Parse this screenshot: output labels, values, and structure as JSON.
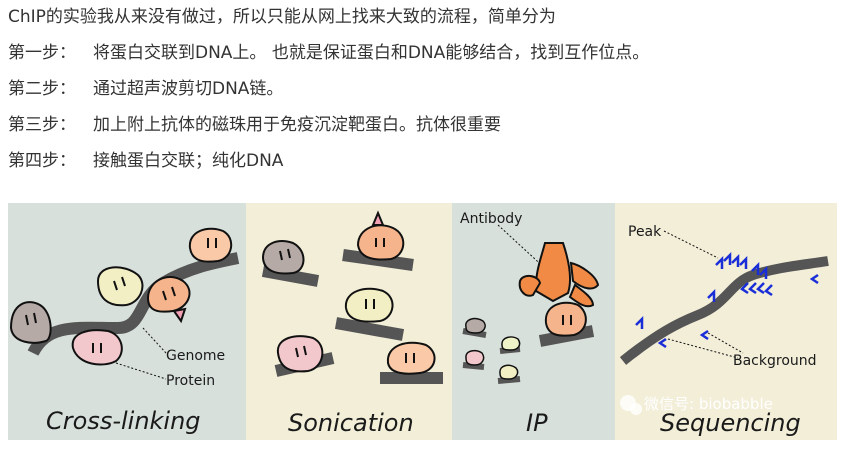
{
  "intro": "ChIP的实验我从来没有做过，所以只能从网上找来大致的流程，简单分为",
  "steps": [
    {
      "label": "第一步：",
      "text": "将蛋白交联到DNA上。 也就是保证蛋白和DNA能够结合，找到互作位点。"
    },
    {
      "label": "第二步：",
      "text": "通过超声波剪切DNA链。"
    },
    {
      "label": "第三步：",
      "text": "加上附上抗体的磁珠用于免疫沉淀靶蛋白。抗体很重要"
    },
    {
      "label": "第四步：",
      "text": "接触蛋白交联；纯化DNA"
    }
  ],
  "figure": {
    "panels": [
      {
        "title": "Cross-linking",
        "color": "#d8e0db"
      },
      {
        "title": "Sonication",
        "color": "#f2eed8"
      },
      {
        "title": "IP",
        "color": "#d8e0db"
      },
      {
        "title": "Sequencing",
        "color": "#f2eed8"
      }
    ],
    "labels": {
      "genome": "Genome",
      "protein": "Protein",
      "antibody": "Antibody",
      "peak": "Peak",
      "background": "Background"
    },
    "watermark": "微信号: biobabble",
    "colors": {
      "dna": "#555555",
      "antibody": "#f08a45",
      "reads": "#1a2ed8",
      "protein_grey": "#b5aaa6",
      "protein_yellow": "#f3efc4",
      "protein_orange": "#f5b48b",
      "protein_pink": "#f2c8cc",
      "protein_green": "#eef3c8",
      "protein_peach": "#f9c9a8"
    }
  }
}
